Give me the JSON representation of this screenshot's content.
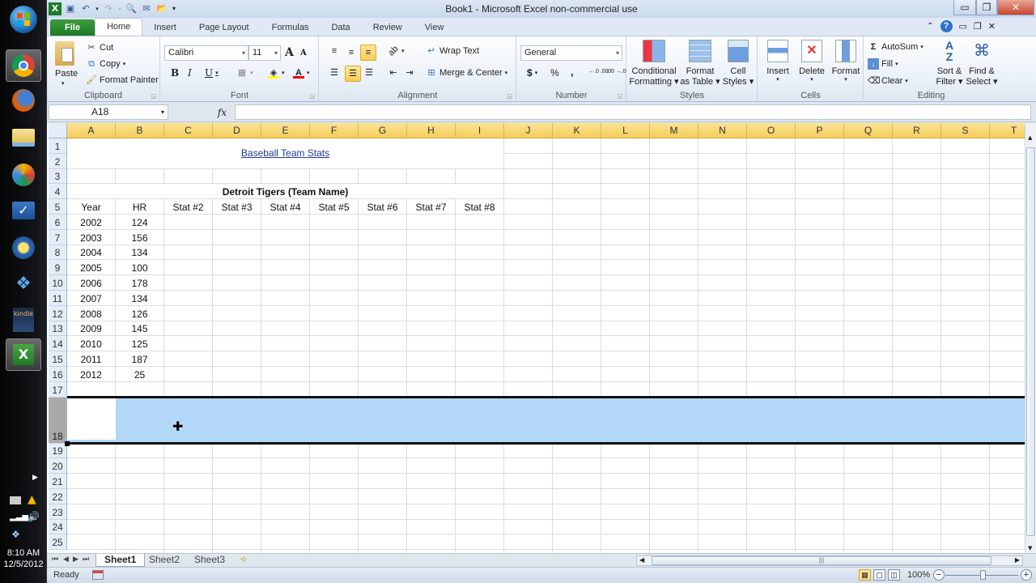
{
  "window": {
    "title": "Book1  -  Microsoft Excel non-commercial use",
    "minimize_icon": "minimize-icon",
    "restore_icon": "restore-icon",
    "close_icon": "close-icon"
  },
  "quick_access": [
    "excel-logo-icon",
    "save-icon",
    "undo-icon",
    "redo-icon",
    "print-preview-icon",
    "email-icon",
    "open-icon",
    "customize-qat-icon"
  ],
  "taskbar": {
    "icons": [
      "windows-start-icon",
      "chrome-icon",
      "firefox-icon",
      "file-explorer-icon",
      "app-icon",
      "checkmark-app-icon",
      "sun-app-icon",
      "dropbox-icon",
      "kindle-icon",
      "excel-icon"
    ],
    "active_icon": "excel-icon",
    "kindle_label": "kindle",
    "clock_time": "8:10 AM",
    "clock_date": "12/5/2012"
  },
  "ribbon_tabs": [
    {
      "label": "File"
    },
    {
      "label": "Home"
    },
    {
      "label": "Insert"
    },
    {
      "label": "Page Layout"
    },
    {
      "label": "Formulas"
    },
    {
      "label": "Data"
    },
    {
      "label": "Review"
    },
    {
      "label": "View"
    }
  ],
  "active_tab": "Home",
  "ribbon": {
    "clipboard": {
      "label": "Clipboard",
      "paste": "Paste",
      "cut": "Cut",
      "copy": "Copy",
      "format_painter": "Format Painter"
    },
    "font": {
      "label": "Font",
      "font_name": "Calibri",
      "font_size": "11",
      "bold": "B",
      "italic": "I",
      "underline": "U",
      "grow": "A",
      "shrink": "A"
    },
    "alignment": {
      "label": "Alignment",
      "wrap_text": "Wrap Text",
      "merge_center": "Merge & Center"
    },
    "number": {
      "label": "Number",
      "format": "General",
      "currency": "$",
      "percent": "%",
      "comma": ",",
      "inc_decimal": "←.0 .00",
      "dec_decimal": ".00 →.0"
    },
    "styles": {
      "label": "Styles",
      "conditional": [
        "Conditional",
        "Formatting ▾"
      ],
      "format_table": [
        "Format",
        "as Table ▾"
      ],
      "cell_styles": [
        "Cell",
        "Styles ▾"
      ]
    },
    "cells": {
      "label": "Cells",
      "insert": "Insert",
      "delete": "Delete",
      "format": "Format"
    },
    "editing": {
      "label": "Editing",
      "autosum": "AutoSum",
      "fill": "Fill",
      "clear": "Clear",
      "sort_filter": [
        "Sort &",
        "Filter ▾"
      ],
      "find_select": [
        "Find &",
        "Select ▾"
      ]
    }
  },
  "formula_bar": {
    "name_box": "A18",
    "fx": "fx",
    "formula": ""
  },
  "columns": [
    "A",
    "B",
    "C",
    "D",
    "E",
    "F",
    "G",
    "H",
    "I",
    "J",
    "K",
    "L",
    "M",
    "N",
    "O",
    "P",
    "Q",
    "R",
    "S",
    "T"
  ],
  "rows": [
    "1",
    "2",
    "3",
    "4",
    "5",
    "6",
    "7",
    "8",
    "9",
    "10",
    "11",
    "12",
    "13",
    "14",
    "15",
    "16",
    "17",
    "18",
    "19",
    "20",
    "21",
    "22",
    "23",
    "24",
    "25"
  ],
  "sheet": {
    "title": "Baseball Team Stats",
    "team": "Detroit Tigers (Team Name)",
    "headers": [
      "Year",
      "HR",
      "Stat #2",
      "Stat #3",
      "Stat #4",
      "Stat #5",
      "Stat #6",
      "Stat #7",
      "Stat #8"
    ],
    "data": [
      {
        "year": "2002",
        "hr": "124"
      },
      {
        "year": "2003",
        "hr": "156"
      },
      {
        "year": "2004",
        "hr": "134"
      },
      {
        "year": "2005",
        "hr": "100"
      },
      {
        "year": "2006",
        "hr": "178"
      },
      {
        "year": "2007",
        "hr": "134"
      },
      {
        "year": "2008",
        "hr": "126"
      },
      {
        "year": "2009",
        "hr": "145"
      },
      {
        "year": "2010",
        "hr": "125"
      },
      {
        "year": "2011",
        "hr": "187"
      },
      {
        "year": "2012",
        "hr": "25"
      }
    ],
    "selected_row": "18"
  },
  "sheet_tabs": [
    {
      "label": "Sheet1",
      "active": true
    },
    {
      "label": "Sheet2",
      "active": false
    },
    {
      "label": "Sheet3",
      "active": false
    }
  ],
  "status": {
    "ready": "Ready",
    "zoom": "100%",
    "zoom_out": "−",
    "zoom_in": "+"
  },
  "colors": {
    "selection_fill": "#b2d7f7",
    "column_header_active": "#f5cd5c",
    "file_tab": "#2a8a2e",
    "link_text": "#1f3a93"
  }
}
